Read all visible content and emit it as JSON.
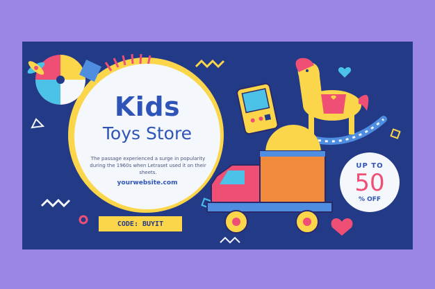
{
  "banner": {
    "title_line1": "Kids",
    "title_line2": "Toys Store",
    "description": "The passage experienced a surge in popularity during the 1960s when Letraset used it on their sheets.",
    "website": "yourwebsite.com",
    "code": "CODE: BUYIT"
  },
  "offer": {
    "up_to": "UP TO",
    "value": "50",
    "off": "% OFF"
  },
  "colors": {
    "background": "#9b86e6",
    "banner": "#233a87",
    "accent_yellow": "#fbd64a",
    "accent_pink": "#ef4f74",
    "title_blue": "#2f54b8"
  },
  "icons": [
    "beach-ball-icon",
    "rocking-horse-icon",
    "handheld-game-icon",
    "toy-truck-icon",
    "heart-icon",
    "zigzag-icon"
  ]
}
